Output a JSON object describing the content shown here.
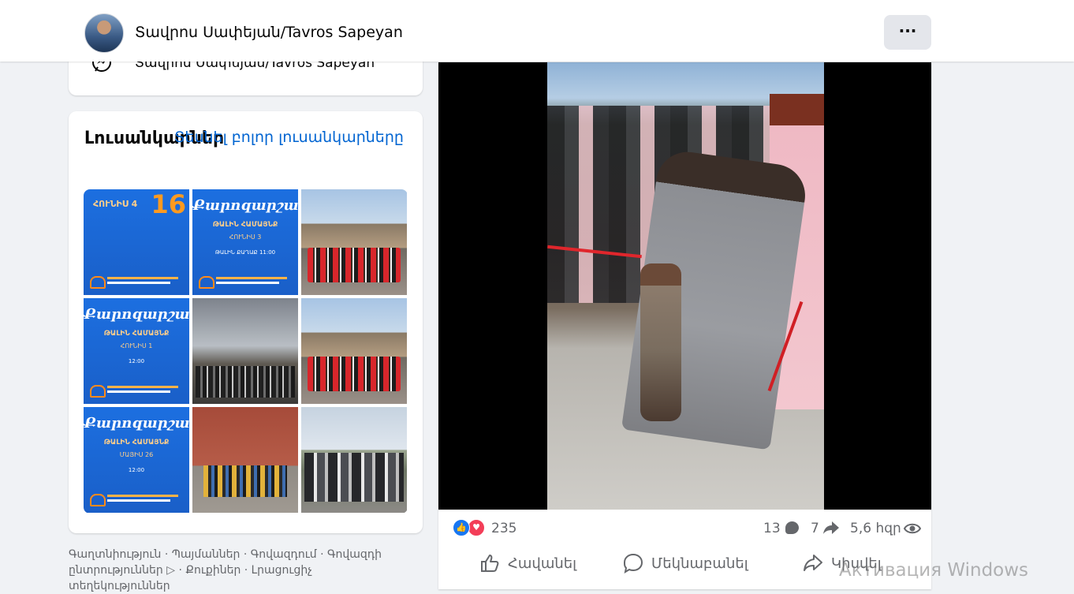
{
  "header": {
    "page_name": "Տավրոս Սափեյան/Tavros Sapeyan",
    "more_label": "···"
  },
  "messenger_card": {
    "text": "Տավրոս Սափեյան/Tavros Sapeyan"
  },
  "photos": {
    "title": "Լուսանկարներ",
    "see_all": "Տեսնել բոլոր լուսանկարները",
    "tiles": [
      {
        "kind": "poster",
        "date": "ՀՈՒՆԻՍ 4",
        "num": "16"
      },
      {
        "kind": "poster",
        "title": "Քարոզարշավ",
        "sub1": "ԹԱԼԻՆ ՀԱՄԱՅՆՔ",
        "sub2": "ՀՈՒՆԻՍ 3",
        "sub3": "ԹԱԼԻՆ ՔԱՂԱՔ  11:00"
      },
      {
        "kind": "photo"
      },
      {
        "kind": "poster",
        "title": "Քարոզարշավ",
        "sub1": "ԹԱԼԻՆ ՀԱՄԱՅՆՔ",
        "sub2": "ՀՈՒՆԻՍ 1",
        "sub3": "12:00"
      },
      {
        "kind": "photo"
      },
      {
        "kind": "photo"
      },
      {
        "kind": "poster",
        "title": "Քարոզարշավ",
        "sub1": "ԹԱԼԻՆ ՀԱՄԱՅՆՔ",
        "sub2": "ՄԱՅԻՍ 26",
        "sub3": "12:00"
      },
      {
        "kind": "photo"
      },
      {
        "kind": "photo"
      }
    ]
  },
  "footer": {
    "links": "Գաղտնիություն · Պայմաններ · Գովազդում · Գովազդի ընտրություններ ▷ · Քուքիներ · Լրացուցիչ տեղեկություններ"
  },
  "post": {
    "reactions_count": "235",
    "comments_count": "13",
    "shares_count": "7",
    "views_count": "5,6 հզր",
    "actions": {
      "like": "Հավանել",
      "comment": "Մեկնաբանել",
      "share": "Կիսվել"
    }
  },
  "watermark": "Активация Windows",
  "colors": {
    "accent": "#1877f2",
    "link": "#0064d1",
    "love": "#f33e58",
    "background": "#f0f2f5",
    "poster_orange": "#ff9a1f"
  },
  "icons": {
    "messenger": "messenger-icon",
    "like": "thumbs-up-icon",
    "comment": "comment-icon",
    "share": "share-icon",
    "views": "eye-icon"
  }
}
